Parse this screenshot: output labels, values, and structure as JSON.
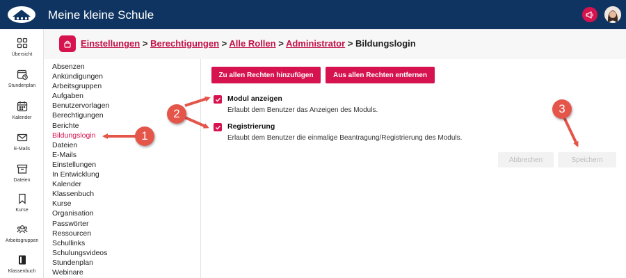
{
  "app": {
    "title": "Meine kleine Schule"
  },
  "rail": [
    {
      "label": "Übersicht",
      "icon": "grid-icon"
    },
    {
      "label": "Stundenplan",
      "icon": "schedule-icon"
    },
    {
      "label": "Kalender",
      "icon": "calendar-icon"
    },
    {
      "label": "E-Mails",
      "icon": "mail-icon"
    },
    {
      "label": "Dateien",
      "icon": "archive-icon"
    },
    {
      "label": "Kurse",
      "icon": "bookmark-icon"
    },
    {
      "label": "Arbeitsgruppen",
      "icon": "group-icon"
    },
    {
      "label": "Klassenbuch",
      "icon": "book-icon"
    }
  ],
  "breadcrumb": {
    "items": [
      "Einstellungen",
      "Berechtigungen",
      "Alle Rollen",
      "Administrator"
    ],
    "separator": ">",
    "current": "Bildungslogin"
  },
  "modules": [
    "Absenzen",
    "Ankündigungen",
    "Arbeitsgruppen",
    "Aufgaben",
    "Benutzervorlagen",
    "Berechtigungen",
    "Berichte",
    "Bildungslogin",
    "Dateien",
    "E-Mails",
    "Einstellungen",
    "In Entwicklung",
    "Kalender",
    "Klassenbuch",
    "Kurse",
    "Organisation",
    "Passwörter",
    "Ressourcen",
    "Schullinks",
    "Schulungsvideos",
    "Stundenplan",
    "Webinare"
  ],
  "active_module": "Bildungslogin",
  "actions": {
    "add_all": "Zu allen Rechten hinzufügen",
    "remove_all": "Aus allen Rechten entfernen"
  },
  "permissions": [
    {
      "title": "Modul anzeigen",
      "description": "Erlaubt dem Benutzer das Anzeigen des Moduls.",
      "checked": true
    },
    {
      "title": "Registrierung",
      "description": "Erlaubt dem Benutzer die einmalige Beantragung/Registrierung des Moduls.",
      "checked": true
    }
  ],
  "footer": {
    "cancel": "Abbrechen",
    "save": "Speichern"
  },
  "callouts": [
    "1",
    "2",
    "3"
  ],
  "colors": {
    "topbar": "#0f3461",
    "accent": "#d6134f",
    "callout": "#e4554a"
  }
}
